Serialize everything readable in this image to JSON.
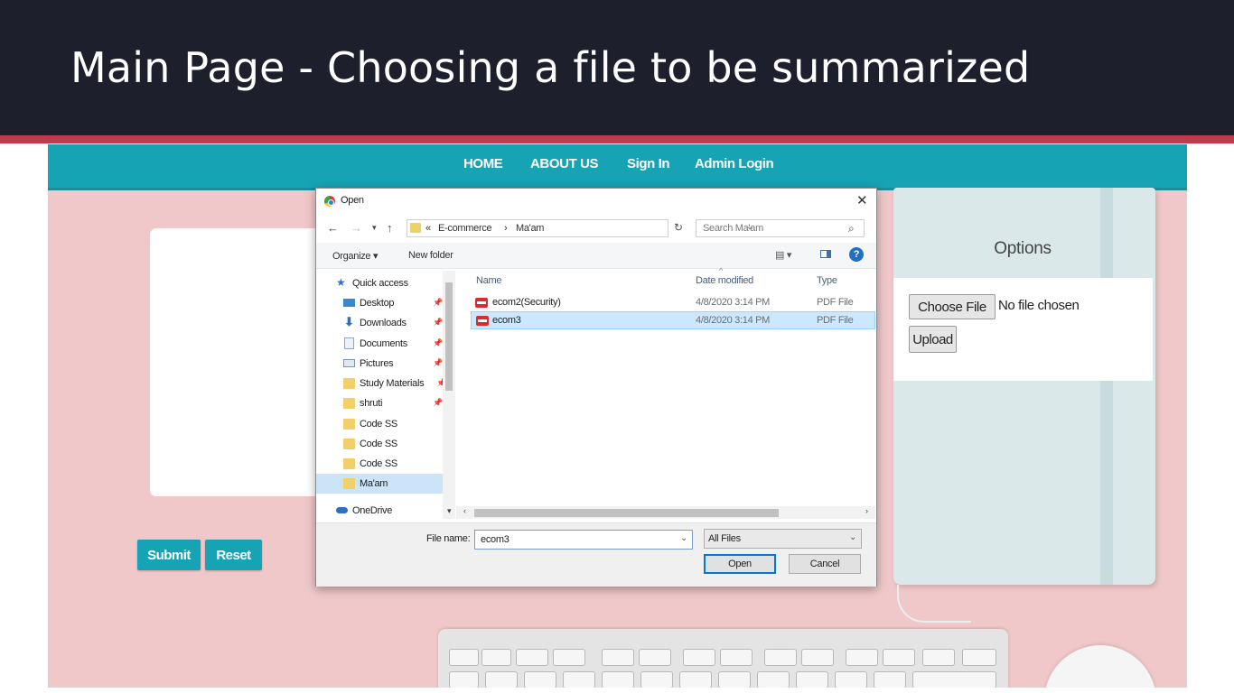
{
  "slide": {
    "title": "Main Page - Choosing a file to be summarized",
    "colors": {
      "header_bg": "#1e1f2c",
      "accent": "#c23a4c"
    }
  },
  "website": {
    "colors": {
      "nav_bg": "#16a3b4",
      "page_bg": "#f0c8c9"
    },
    "nav": [
      "HOME",
      "ABOUT US",
      "Sign In",
      "Admin Login"
    ],
    "buttons": {
      "submit": "Submit",
      "reset": "Reset"
    },
    "options_panel": {
      "title": "Options",
      "choose_file": "Choose File",
      "no_file": "No file chosen",
      "upload": "Upload"
    }
  },
  "dialog": {
    "title": "Open",
    "breadcrumbs": [
      "«",
      "E-commerce",
      "›",
      "Ma'am"
    ],
    "search_placeholder": "Search Ma'am",
    "organize": "Organize ▾",
    "new_folder": "New folder",
    "nav_items": [
      {
        "label": "Quick access",
        "icon": "star-icon"
      },
      {
        "label": "Desktop",
        "icon": "desktop-icon",
        "pinned": true
      },
      {
        "label": "Downloads",
        "icon": "download-icon",
        "pinned": true
      },
      {
        "label": "Documents",
        "icon": "documents-icon",
        "pinned": true
      },
      {
        "label": "Pictures",
        "icon": "pictures-icon",
        "pinned": true
      },
      {
        "label": "Study Materials",
        "icon": "folder-icon",
        "pinned": true
      },
      {
        "label": "shruti",
        "icon": "folder-icon",
        "pinned": true
      },
      {
        "label": "Code SS",
        "icon": "folder-icon"
      },
      {
        "label": "Code SS",
        "icon": "folder-icon"
      },
      {
        "label": "Code SS",
        "icon": "folder-icon"
      },
      {
        "label": "Ma'am",
        "icon": "folder-icon",
        "selected": true
      },
      {
        "label": "OneDrive",
        "icon": "onedrive-icon"
      }
    ],
    "columns": [
      "Name",
      "Date modified",
      "Type"
    ],
    "files": [
      {
        "name": "ecom2(Security)",
        "date": "4/8/2020 3:14 PM",
        "type": "PDF File"
      },
      {
        "name": "ecom3",
        "date": "4/8/2020 3:14 PM",
        "type": "PDF File",
        "selected": true
      }
    ],
    "file_name_label": "File name:",
    "file_name_value": "ecom3",
    "file_type": "All Files",
    "open_button": "Open",
    "cancel_button": "Cancel"
  }
}
